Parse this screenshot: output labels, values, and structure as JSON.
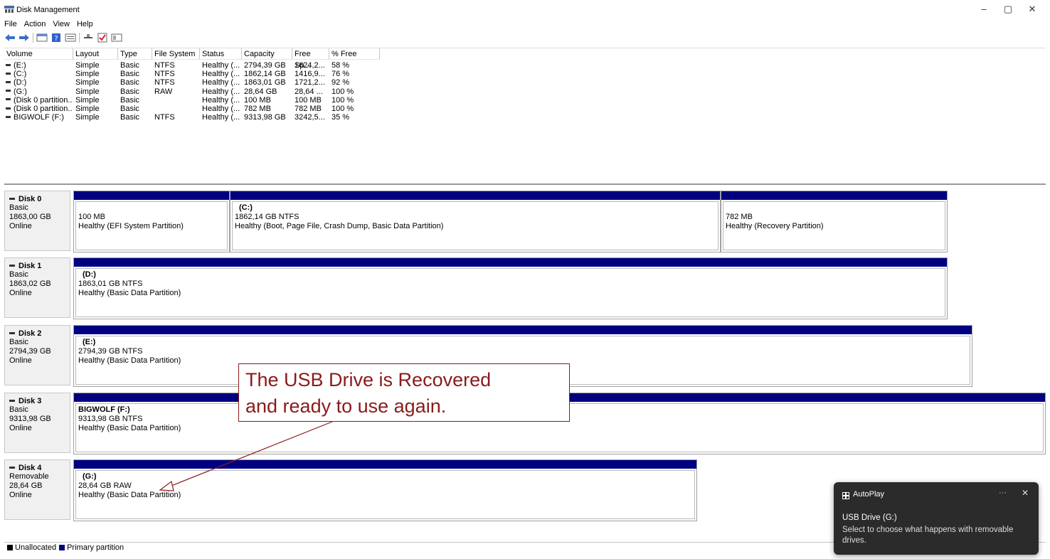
{
  "window": {
    "title": "Disk Management",
    "minimize": "–",
    "maximize": "▢",
    "close": "✕"
  },
  "menu": [
    "File",
    "Action",
    "View",
    "Help"
  ],
  "toolbar": {
    "icons": [
      "back-icon",
      "forward-icon",
      "disk-list-icon",
      "help-icon",
      "properties-icon",
      "connect-icon",
      "check-icon",
      "view-icon"
    ]
  },
  "volume_list": {
    "columns": [
      "Volume",
      "Layout",
      "Type",
      "File System",
      "Status",
      "Capacity",
      "Free Sp...",
      "% Free"
    ],
    "rows": [
      [
        "(E:)",
        "Simple",
        "Basic",
        "NTFS",
        "Healthy (...",
        "2794,39 GB",
        "1624,2...",
        "58 %"
      ],
      [
        "(C:)",
        "Simple",
        "Basic",
        "NTFS",
        "Healthy (...",
        "1862,14 GB",
        "1416,9...",
        "76 %"
      ],
      [
        "(D:)",
        "Simple",
        "Basic",
        "NTFS",
        "Healthy (...",
        "1863,01 GB",
        "1721,2...",
        "92 %"
      ],
      [
        "(G:)",
        "Simple",
        "Basic",
        "RAW",
        "Healthy (...",
        "28,64 GB",
        "28,64 ...",
        "100 %"
      ],
      [
        "(Disk 0 partition...",
        "Simple",
        "Basic",
        "",
        "Healthy (...",
        "100 MB",
        "100 MB",
        "100 %"
      ],
      [
        "(Disk 0 partition...",
        "Simple",
        "Basic",
        "",
        "Healthy (...",
        "782 MB",
        "782 MB",
        "100 %"
      ],
      [
        "BIGWOLF (F:)",
        "Simple",
        "Basic",
        "NTFS",
        "Healthy (...",
        "9313,98 GB",
        "3242,5...",
        "35 %"
      ]
    ]
  },
  "disks": [
    {
      "name": "Disk 0",
      "type": "Basic",
      "size": "1863,00 GB",
      "status": "Online",
      "partitions": [
        {
          "name": "",
          "size": "100 MB",
          "status": "Healthy (EFI System Partition)"
        },
        {
          "name": "(C:)",
          "size": "1862,14 GB NTFS",
          "status": "Healthy (Boot, Page File, Crash Dump, Basic Data Partition)"
        },
        {
          "name": "",
          "size": "782 MB",
          "status": "Healthy (Recovery Partition)"
        }
      ]
    },
    {
      "name": "Disk 1",
      "type": "Basic",
      "size": "1863,02 GB",
      "status": "Online",
      "partitions": [
        {
          "name": "(D:)",
          "size": "1863,01 GB NTFS",
          "status": "Healthy (Basic Data Partition)"
        }
      ]
    },
    {
      "name": "Disk 2",
      "type": "Basic",
      "size": "2794,39 GB",
      "status": "Online",
      "partitions": [
        {
          "name": "(E:)",
          "size": "2794,39 GB NTFS",
          "status": "Healthy (Basic Data Partition)"
        }
      ]
    },
    {
      "name": "Disk 3",
      "type": "Basic",
      "size": "9313,98 GB",
      "status": "Online",
      "partitions": [
        {
          "name": "BIGWOLF  (F:)",
          "size": "9313,98 GB NTFS",
          "status": "Healthy (Basic Data Partition)"
        }
      ]
    },
    {
      "name": "Disk 4",
      "type": "Removable",
      "size": "28,64 GB",
      "status": "Online",
      "partitions": [
        {
          "name": "(G:)",
          "size": "28,64 GB RAW",
          "status": "Healthy (Basic Data Partition)"
        }
      ]
    }
  ],
  "legend": {
    "unallocated": {
      "label": "Unallocated",
      "color": "#000000"
    },
    "primary": {
      "label": "Primary partition",
      "color": "#000080"
    }
  },
  "annotation": {
    "line1": "The USB Drive is Recovered",
    "line2": "and ready to use again.",
    "color": "#8b1a1a"
  },
  "toast": {
    "title": "AutoPlay",
    "more": "···",
    "close": "✕",
    "heading": "USB Drive (G:)",
    "body": "Select to choose what happens with removable drives."
  }
}
